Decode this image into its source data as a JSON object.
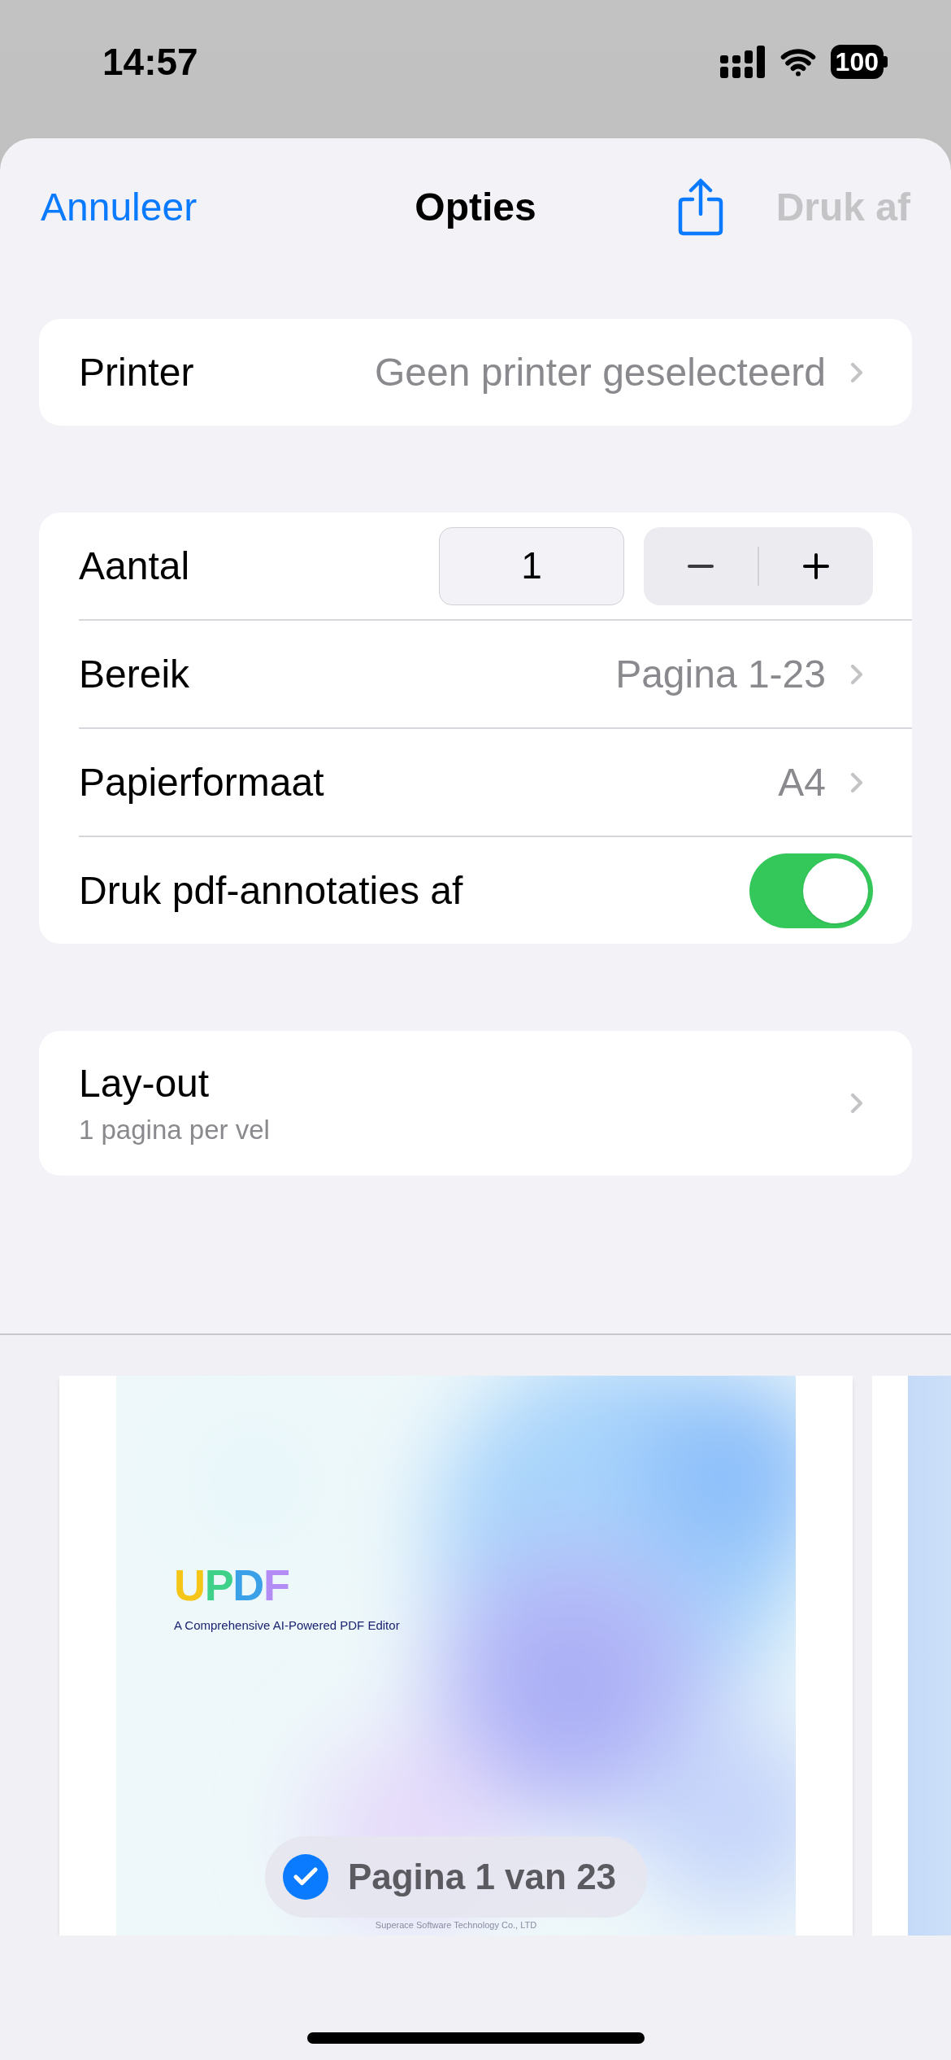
{
  "status_bar": {
    "time": "14:57",
    "battery": "100"
  },
  "nav": {
    "cancel": "Annuleer",
    "title": "Opties",
    "print": {
      "label": "Druk af",
      "disabled": true
    }
  },
  "printer": {
    "label": "Printer",
    "value": "Geen printer geselecteerd"
  },
  "options": [
    {
      "kind": "stepper",
      "label": "Aantal",
      "value": "1"
    },
    {
      "kind": "link",
      "label": "Bereik",
      "value": "Pagina 1-23"
    },
    {
      "kind": "link",
      "label": "Papierformaat",
      "value": "A4"
    },
    {
      "kind": "toggle",
      "label": "Druk pdf-annotaties af",
      "on": true
    }
  ],
  "layout": {
    "label": "Lay-out",
    "detail": "1 pagina per vel"
  },
  "preview": {
    "logo": "UPDF",
    "tagline": "A Comprehensive AI-Powered PDF Editor",
    "footer": "Superace Software Technology Co., LTD",
    "badge": {
      "label": "Pagina 1 van 23",
      "checked": true
    }
  }
}
